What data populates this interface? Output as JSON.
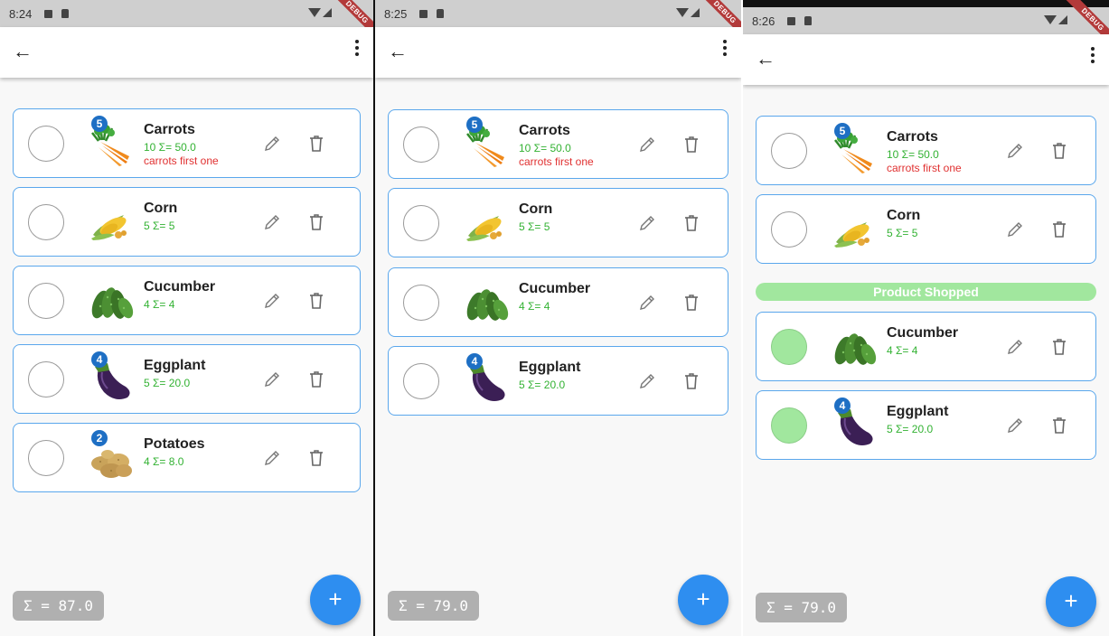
{
  "screens": [
    {
      "time": "8:24",
      "items": [
        {
          "name": "Carrots",
          "qty": "10  Σ= 50.0",
          "note": "carrots first one",
          "badge": "5",
          "img": "carrot-image",
          "checked": false
        },
        {
          "name": "Corn",
          "qty": "5  Σ= 5",
          "note": "",
          "badge": "",
          "img": "corn-image",
          "checked": false
        },
        {
          "name": "Cucumber",
          "qty": "4  Σ= 4",
          "note": "",
          "badge": "",
          "img": "cucumber-image",
          "checked": false
        },
        {
          "name": "Eggplant",
          "qty": "5  Σ= 20.0",
          "note": "",
          "badge": "4",
          "img": "eggplant-image",
          "checked": false
        },
        {
          "name": "Potatoes",
          "qty": "4  Σ= 8.0",
          "note": "",
          "badge": "2",
          "img": "potato-image",
          "checked": false
        }
      ],
      "total": "Σ = 87.0"
    },
    {
      "time": "8:25",
      "items": [
        {
          "name": "Carrots",
          "qty": "10  Σ= 50.0",
          "note": "carrots first one",
          "badge": "5",
          "img": "carrot-image",
          "checked": false
        },
        {
          "name": "Corn",
          "qty": "5  Σ= 5",
          "note": "",
          "badge": "",
          "img": "corn-image",
          "checked": false
        },
        {
          "name": "Cucumber",
          "qty": "4  Σ= 4",
          "note": "",
          "badge": "",
          "img": "cucumber-image",
          "checked": false
        },
        {
          "name": "Eggplant",
          "qty": "5  Σ= 20.0",
          "note": "",
          "badge": "4",
          "img": "eggplant-image",
          "checked": false
        }
      ],
      "total": "Σ = 79.0"
    },
    {
      "time": "8:26",
      "items": [
        {
          "name": "Carrots",
          "qty": "10  Σ= 50.0",
          "note": "carrots first one",
          "badge": "5",
          "img": "carrot-image",
          "checked": false
        },
        {
          "name": "Corn",
          "qty": "5  Σ= 5",
          "note": "",
          "badge": "",
          "img": "corn-image",
          "checked": false
        },
        {
          "name": "Cucumber",
          "qty": "4  Σ= 4",
          "note": "",
          "badge": "",
          "img": "cucumber-image",
          "checked": true
        },
        {
          "name": "Eggplant",
          "qty": "5  Σ= 20.0",
          "note": "",
          "badge": "4",
          "img": "eggplant-image",
          "checked": true
        }
      ],
      "shopped_label": "Product Shopped",
      "total": "Σ = 79.0"
    }
  ],
  "debug_label": "DEBUG",
  "fab_label": "+",
  "colors": {
    "accent": "#2e8ef0",
    "card_border": "#5aa7ec",
    "quantity_text": "#33b233",
    "note_text": "#e03030",
    "shopped": "#a1e79e",
    "badge": "#1e6fc4"
  }
}
